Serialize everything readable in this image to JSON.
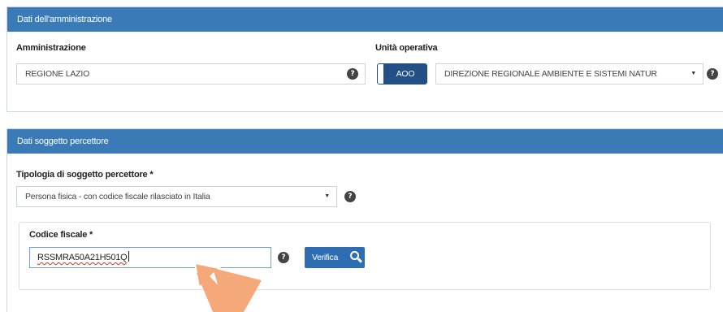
{
  "amministrazione_panel": {
    "header": "Dati dell'amministrazione",
    "amministrazione_label": "Amministrazione",
    "amministrazione_value": "REGIONE LAZIO",
    "unita_label": "Unità operativa",
    "aoo_toggle_label": "AOO",
    "unita_value": "DIREZIONE REGIONALE AMBIENTE E SISTEMI NATUR"
  },
  "percettore_panel": {
    "header": "Dati soggetto percettore",
    "tipologia_label": "Tipologia di soggetto percettore *",
    "tipologia_value": "Persona fisica - con codice fiscale rilasciato in Italia",
    "codice_label": "Codice fiscale *",
    "codice_value": "RSSMRA50A21H501Q",
    "verifica_label": "Verifica"
  },
  "icons": {
    "help": "?",
    "caret": "▼"
  },
  "colors": {
    "header_blue": "#3a7bb7",
    "button_blue": "#2f6db3",
    "toggle_blue": "#214f86",
    "arrow_orange": "#f5a97a"
  }
}
